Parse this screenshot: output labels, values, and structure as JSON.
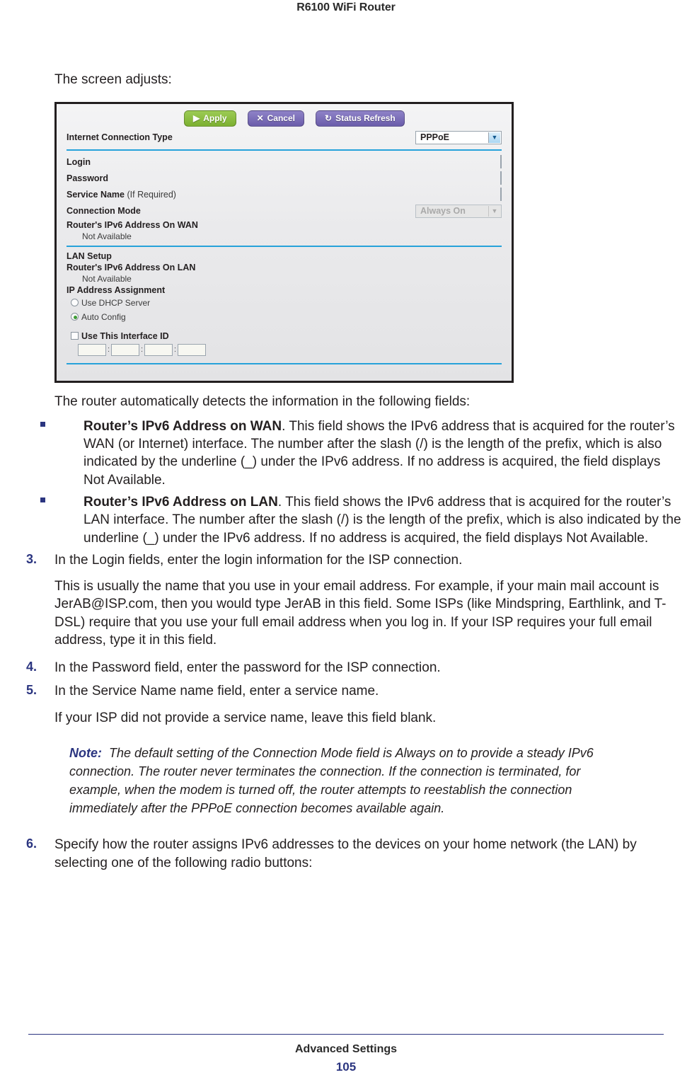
{
  "header": {
    "title": "R6100 WiFi Router"
  },
  "intro": {
    "lead": "The screen adjusts:"
  },
  "screenshot": {
    "buttons": [
      {
        "label": "Apply",
        "icon": "play-triangle-icon",
        "glyph": "▶",
        "color": "#7cb030"
      },
      {
        "label": "Cancel",
        "icon": "close-x-icon",
        "glyph": "✕",
        "color": "#6a5caa"
      },
      {
        "label": "Status Refresh",
        "icon": "refresh-icon",
        "glyph": "↻",
        "color": "#6a5caa"
      }
    ],
    "connection_type": {
      "label": "Internet Connection Type",
      "value": "PPPoE"
    },
    "fields": [
      {
        "label": "Login",
        "sub": "",
        "value": ""
      },
      {
        "label": "Password",
        "sub": "",
        "value": ""
      },
      {
        "label": "Service Name",
        "sub": " (If Required)",
        "value": ""
      }
    ],
    "connection_mode": {
      "label": "Connection Mode",
      "value": "Always On",
      "disabled": true
    },
    "wan": {
      "label": "Router's IPv6 Address On WAN",
      "value": "Not Available"
    },
    "lan_setup": {
      "heading": "LAN Setup",
      "label": "Router's IPv6 Address On LAN",
      "value": "Not Available"
    },
    "ip_assignment": {
      "heading": "IP Address Assignment",
      "options": [
        {
          "label": "Use DHCP Server",
          "selected": false
        },
        {
          "label": "Auto Config",
          "selected": true
        }
      ]
    },
    "interface_id": {
      "checkbox_label": "Use This Interface ID",
      "checked": false,
      "segments": [
        "",
        "",
        "",
        ""
      ],
      "separator": ":"
    }
  },
  "body": {
    "detects_intro": "The router automatically detects the information in the following fields:",
    "bullets": [
      {
        "term": "Router’s IPv6 Address on WAN",
        "text": ". This field shows the IPv6 address that is acquired for the router’s WAN (or Internet) interface. The number after the slash (/) is the length of the prefix, which is also indicated by the underline (_) under the IPv6 address. If no address is acquired, the field displays Not Available."
      },
      {
        "term": "Router’s IPv6 Address on LAN",
        "text": ". This field shows the IPv6 address that is acquired for the router’s LAN interface. The number after the slash (/) is the length of the prefix, which is also indicated by the underline (_) under the IPv6 address. If no address is acquired, the field displays Not Available."
      }
    ],
    "steps": [
      {
        "num": "3.",
        "text": "In the Login fields, enter the login information for the ISP connection.",
        "detail": "This is usually the name that you use in your email address. For example, if your main mail account is JerAB@ISP.com, then you would type JerAB in this field. Some ISPs (like Mindspring, Earthlink, and T-DSL) require that you use your full email address when you log in. If your ISP requires your full email address, type it in this field."
      },
      {
        "num": "4.",
        "text": "In the Password field, enter the password for the ISP connection.",
        "detail": ""
      },
      {
        "num": "5.",
        "text": "In the Service Name name field, enter a service name.",
        "detail": "If your ISP did not provide a service name, leave this field blank."
      }
    ],
    "note": {
      "label": "Note:",
      "text": "The default setting of the Connection Mode field is Always on to provide a steady IPv6 connection. The router never terminates the connection. If the connection is terminated, for example, when the modem is turned off, the router attempts to reestablish the connection immediately after the PPPoE connection becomes available again."
    },
    "final_step": {
      "num": "6.",
      "text": "Specify how the router assigns IPv6 addresses to the devices on your home network (the LAN) by selecting one of the following radio buttons:"
    }
  },
  "footer": {
    "section": "Advanced Settings",
    "page": "105"
  }
}
